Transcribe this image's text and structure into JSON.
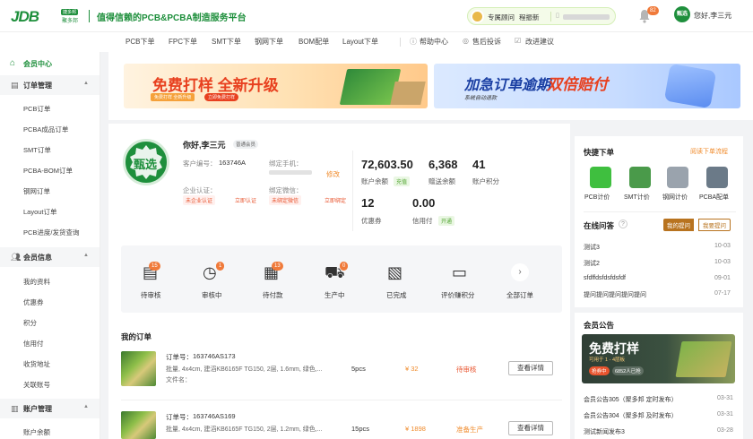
{
  "header": {
    "logo": "JDB",
    "logo_tag": "捷多邦",
    "logo_cn": "聚多邦",
    "slogan": "值得信赖的PCB&PCBA制造服务平台",
    "advisor_label": "专属顾问",
    "advisor_name": "程振新",
    "notification_count": "82",
    "avatar_text": "甄选",
    "greeting": "您好,李三元"
  },
  "nav": [
    "PCB下单",
    "FPC下单",
    "SMT下单",
    "钢网下单",
    "BOM配单",
    "Layout下单",
    "帮助中心",
    "售后投诉",
    "改进建议"
  ],
  "sidebar": {
    "home": "会员中心",
    "sections": [
      {
        "title": "订单管理",
        "items": [
          "PCB订单",
          "PCBA成品订单",
          "SMT订单",
          "PCBA-BOM订单",
          "钢网订单",
          "Layout订单",
          "PCB进度/发货查询"
        ]
      },
      {
        "title": "会员信息",
        "items": [
          "我的资料",
          "优惠券",
          "积分",
          "信用付",
          "收货地址",
          "关联账号"
        ]
      },
      {
        "title": "账户管理",
        "items": [
          "账户余额"
        ]
      }
    ]
  },
  "banners": {
    "left_title": "免费打样 全新升级",
    "left_sub": "免费打样 全新升级",
    "left_btn": "立即免费打样",
    "right_title_a": "加急订单逾期",
    "right_title_b": "双倍赔付",
    "right_sub": "系统自动退款"
  },
  "profile": {
    "badge": "甄选",
    "greeting": "你好,李三元",
    "level": "普通会员",
    "customer_no_label": "客户编号：",
    "customer_no": "163746A",
    "phone_label": "绑定手机：",
    "phone_action": "修改",
    "enterprise_label": "企业认证：",
    "enterprise_status": "未企业认证",
    "enterprise_action": "立即认证",
    "wechat_label": "绑定微信：",
    "wechat_status": "未绑定微信",
    "wechat_action": "立即绑定"
  },
  "stats": [
    {
      "value": "72,603.50",
      "label": "账户余额",
      "tag": "充值"
    },
    {
      "value": "6,368",
      "label": "赠送余额"
    },
    {
      "value": "41",
      "label": "账户积分"
    },
    {
      "value": "12",
      "label": "优惠券"
    },
    {
      "value": "0.00",
      "label": "信用付",
      "tag": "开通"
    }
  ],
  "order_status": [
    {
      "label": "待审核",
      "count": "15"
    },
    {
      "label": "审核中",
      "count": "1"
    },
    {
      "label": "待付款",
      "count": "13"
    },
    {
      "label": "生产中",
      "count": "0"
    },
    {
      "label": "已完成",
      "count": ""
    },
    {
      "label": "评价赚积分",
      "count": ""
    },
    {
      "label": "全部订单",
      "count": ""
    }
  ],
  "my_orders": {
    "title": "我的订单",
    "orders": [
      {
        "no_label": "订单号：",
        "no": "163746AS173",
        "spec": "批量, 4x4cm, 建滔KB6165F TG150, 2层, 1.6mm, 绿色,...",
        "file": "文件名：",
        "qty": "5pcs",
        "price": "¥ 32",
        "status": "待审核",
        "action": "查看详情"
      },
      {
        "no_label": "订单号：",
        "no": "163746AS169",
        "spec": "批量, 4x4cm, 建滔KB6165F TG150, 2层, 1.2mm, 绿色,...",
        "file": "",
        "qty": "15pcs",
        "price": "¥ 1898",
        "status": "准备生产",
        "action": "查看详情"
      }
    ]
  },
  "quick_order": {
    "title": "快捷下单",
    "link": "阅读下单流程",
    "items": [
      {
        "label": "PCB计价",
        "color": "#3fbf3f"
      },
      {
        "label": "SMT计价",
        "color": "#4a9a4a"
      },
      {
        "label": "钢网计价",
        "color": "#9aa3ad"
      },
      {
        "label": "PCBA配单",
        "color": "#6b7a88"
      }
    ]
  },
  "qa": {
    "title": "在线问答",
    "tab_active": "我的提问",
    "tab_other": "我要提问",
    "items": [
      {
        "q": "测试3",
        "date": "10-03"
      },
      {
        "q": "测试2",
        "date": "10-03"
      },
      {
        "q": "sfdffdsfdsfdsfdf",
        "date": "09-01"
      },
      {
        "q": "提问提问提问提问提问",
        "date": "07-17"
      }
    ]
  },
  "notice": {
    "title": "会员公告",
    "banner_title": "免费打样",
    "banner_sub": "可用于 1 - 4层板",
    "banner_btn": "抢券中",
    "banner_count": "6852人已抢",
    "items": [
      {
        "t": "会员公告305（聚多邦 定时发布）",
        "date": "03-31"
      },
      {
        "t": "会员公告304（聚多邦 及时发布）",
        "date": "03-31"
      },
      {
        "t": "测试新闻发布3",
        "date": "03-28"
      }
    ]
  },
  "colors": {
    "brand": "#1e8f3c",
    "orange": "#f08c2e",
    "red": "#e8542e"
  }
}
